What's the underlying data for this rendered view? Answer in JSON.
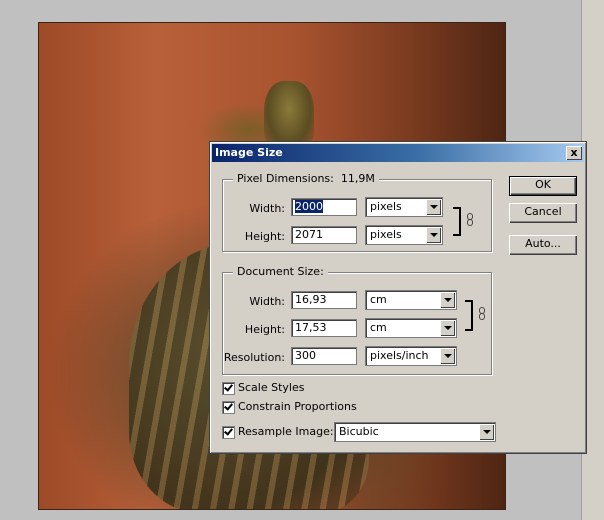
{
  "dialog": {
    "title": "Image Size",
    "close_glyph": "x",
    "pixel_dimensions": {
      "label": "Pixel Dimensions:",
      "value": "11,9M",
      "width_label": "Width:",
      "width_value": "2000",
      "width_unit": "pixels",
      "height_label": "Height:",
      "height_value": "2071",
      "height_unit": "pixels"
    },
    "document_size": {
      "label": "Document Size:",
      "width_label": "Width:",
      "width_value": "16,93",
      "width_unit": "cm",
      "height_label": "Height:",
      "height_value": "17,53",
      "height_unit": "cm",
      "resolution_label": "Resolution:",
      "resolution_value": "300",
      "resolution_unit": "pixels/inch"
    },
    "options": {
      "scale_styles": "Scale Styles",
      "constrain_proportions": "Constrain Proportions",
      "resample_image": "Resample Image:",
      "resample_method": "Bicubic"
    },
    "buttons": {
      "ok": "OK",
      "cancel": "Cancel",
      "auto": "Auto..."
    }
  },
  "colors": {
    "title_bar": "#0a246a",
    "dialog_face": "#d4d0c8",
    "selection": "#0a246a"
  }
}
